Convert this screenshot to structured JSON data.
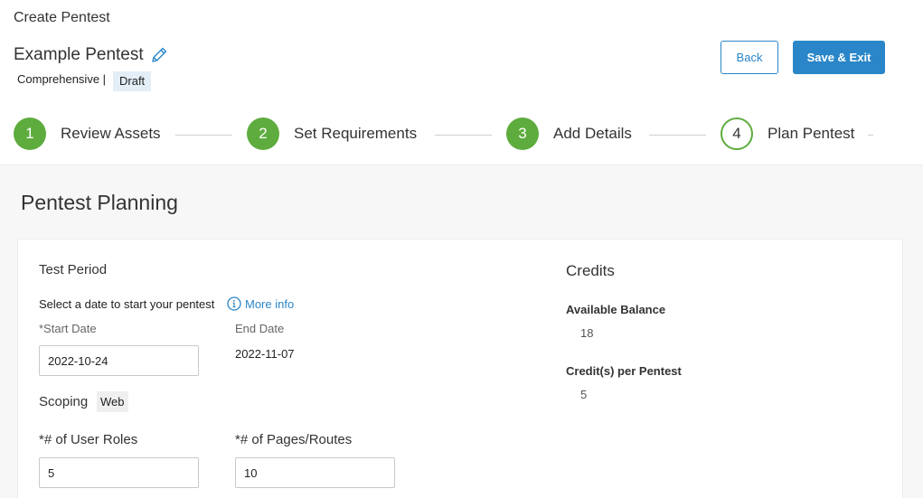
{
  "header": {
    "page_title": "Create Pentest",
    "pentest_name": "Example Pentest",
    "pentest_type": "Comprehensive |",
    "status_badge": "Draft",
    "back_label": "Back",
    "save_label": "Save & Exit",
    "accent_color": "#2a86c8"
  },
  "steps": [
    {
      "number": "1",
      "label": "Review Assets",
      "state": "completed"
    },
    {
      "number": "2",
      "label": "Set Requirements",
      "state": "completed"
    },
    {
      "number": "3",
      "label": "Add Details",
      "state": "completed"
    },
    {
      "number": "4",
      "label": "Plan Pentest",
      "state": "current"
    }
  ],
  "step_color": "#5eac3e",
  "main": {
    "section_title": "Pentest Planning",
    "test_period": {
      "title": "Test Period",
      "instruction": "Select a date to start your pentest",
      "more_info": "More info",
      "start_label": "*Start Date",
      "start_value": "2022-10-24",
      "end_label": "End Date",
      "end_value": "2022-11-07"
    },
    "scoping": {
      "title": "Scoping",
      "badge": "Web",
      "roles_label": "*# of User Roles",
      "roles_value": "5",
      "pages_label": "*# of Pages/Routes",
      "pages_value": "10"
    },
    "credits": {
      "title": "Credits",
      "available_label": "Available Balance",
      "available_value": "18",
      "per_pentest_label": "Credit(s) per Pentest",
      "per_pentest_value": "5"
    }
  }
}
